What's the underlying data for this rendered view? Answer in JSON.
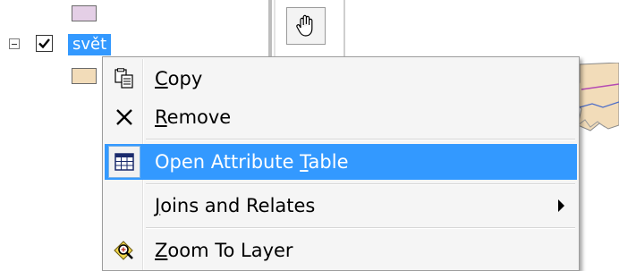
{
  "toc": {
    "layer": {
      "name": "svět",
      "checked": true,
      "expanded": true
    },
    "colors": {
      "top_swatch": "#e4cfe6",
      "layer_swatch": "#f2dcb9",
      "selection": "#3399ff"
    }
  },
  "toolbar": {
    "pan_icon": "hand-icon"
  },
  "context_menu": {
    "items": [
      {
        "pre": "",
        "mnemonic": "C",
        "post": "opy",
        "icon": "copy-icon"
      },
      {
        "pre": "",
        "mnemonic": "R",
        "post": "emove",
        "icon": "remove-x-icon"
      },
      {
        "pre": "Open Attribute ",
        "mnemonic": "T",
        "post": "able",
        "icon": "attribute-table-icon",
        "highlighted": true
      },
      {
        "pre": "",
        "mnemonic": "J",
        "post": "oins and Relates",
        "icon": "",
        "has_submenu": true
      },
      {
        "pre": "",
        "mnemonic": "Z",
        "post": "oom To Layer",
        "icon": "zoom-to-layer-icon"
      }
    ],
    "colors": {
      "highlight": "#3399ff",
      "background": "#f5f5f5"
    }
  }
}
